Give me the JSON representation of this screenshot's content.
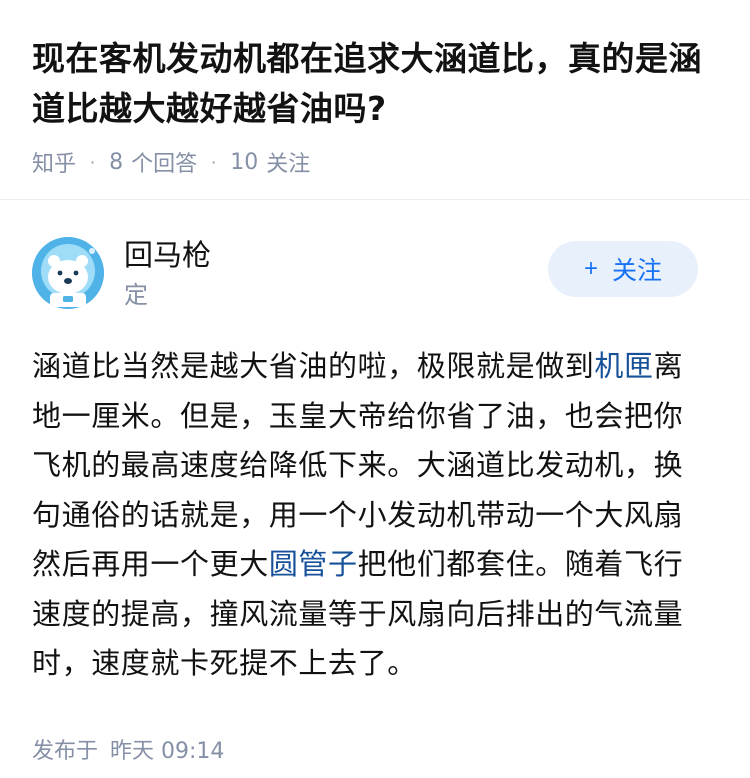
{
  "question": {
    "title": "现在客机发动机都在追求大涵道比，真的是涵道比越大越好越省油吗?",
    "source": "知乎",
    "answers_count": "8",
    "answers_label": "个回答",
    "followers_count": "10",
    "followers_label": "关注"
  },
  "answer": {
    "author_name": "回马枪",
    "author_sub": "定",
    "follow_button": "关注",
    "content": {
      "p1": "涵道比当然是越大省油的啦，极限就是做到",
      "link1": "机匣",
      "p2": "离地一厘米。但是，玉皇大帝给你省了油，也会把你飞机的最高速度给降低下来。大涵道比发动机，换句通俗的话就是，用一个小发动机带动一个大风扇然后再用一个更大",
      "link2": "圆管子",
      "p3": "把他们都套住。随着飞行速度的提高，撞风流量等于风扇向后排出的气流量时，速度就卡死提不上去了。"
    },
    "publish_label": "发布于",
    "publish_time": "昨天 09:14"
  },
  "colors": {
    "link": "#175199",
    "follow_text": "#1772f6",
    "follow_bg": "#e8f0fb",
    "meta": "#8590a6",
    "avatar_bg": "#4fb3e8"
  },
  "icons": {
    "avatar": "polar-bear-astronaut-avatar",
    "plus": "plus-icon"
  }
}
